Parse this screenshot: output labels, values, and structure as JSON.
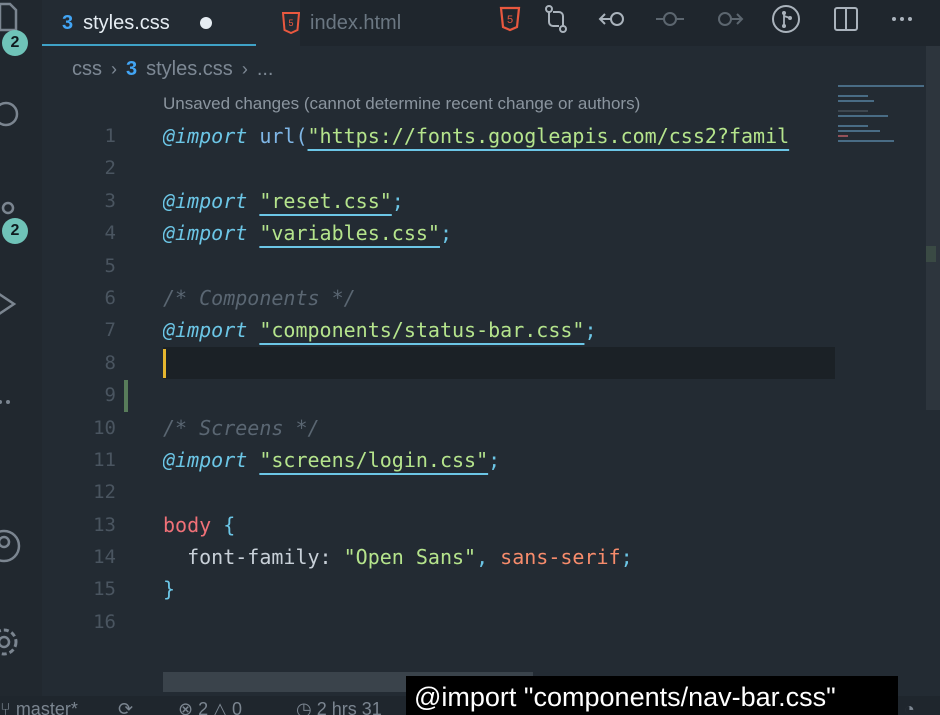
{
  "tabs": [
    {
      "label": "styles.css",
      "icon": "css3-icon",
      "active": true,
      "dirty": true
    },
    {
      "label": "index.html",
      "icon": "html5-icon",
      "active": false
    }
  ],
  "breadcrumb": {
    "folder": "css",
    "file": "styles.css",
    "more": "..."
  },
  "badges": {
    "explorer": "2",
    "source_control": "2"
  },
  "blame": "Unsaved changes (cannot determine recent change or authors)",
  "line_numbers": [
    "1",
    "2",
    "3",
    "4",
    "5",
    "6",
    "7",
    "8",
    "9",
    "10",
    "11",
    "12",
    "13",
    "14",
    "15",
    "16"
  ],
  "code": {
    "l1_kw": "@import",
    "l1_fn": "url(",
    "l1_str": "\"https://fonts.googleapis.com/css2?famil",
    "l3_kw": "@import",
    "l3_str": "\"reset.css\"",
    "l3_end": ";",
    "l4_kw": "@import",
    "l4_str": "\"variables.css\"",
    "l4_end": ";",
    "l6_cmt": "/* Components */",
    "l7_kw": "@import",
    "l7_str": "\"components/status-bar.css\"",
    "l7_end": ";",
    "l10_cmt": "/* Screens */",
    "l11_kw": "@import",
    "l11_str": "\"screens/login.css\"",
    "l11_end": ";",
    "l13_sel": "body",
    "l13_brace": " {",
    "l14_prop": "  font-family: ",
    "l14_val": "\"Open Sans\"",
    "l14_comma": ", ",
    "l14_kw": "sans-serif",
    "l14_end": ";",
    "l15_brace": "}"
  },
  "status": {
    "branch": "master*",
    "problems": "2",
    "warnings": "0",
    "time": "2 hrs 31"
  },
  "tooltip": "@import \"components/nav-bar.css\"",
  "colors": {
    "accent": "#3fa2c7",
    "badge": "#6fc3b8",
    "caret": "#e5b62f"
  }
}
